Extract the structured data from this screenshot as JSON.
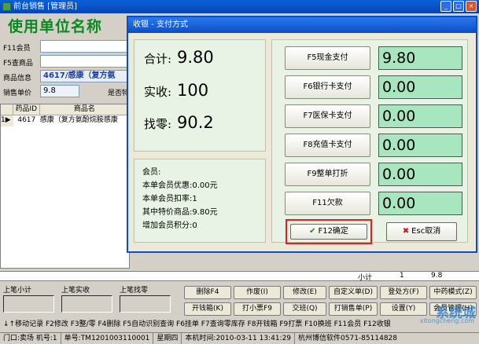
{
  "main": {
    "title": "前台销售 [管理员]",
    "company_name": "使用单位名称",
    "form": {
      "member_label": "F11会员",
      "search_label": "F5查商品",
      "product_info_label": "商品信息",
      "product_info_value": "4617/感康（复方氨",
      "unit_price_label": "销售单价",
      "unit_price_value": "9.8",
      "special_label": "是否特"
    },
    "grid": {
      "columns": [
        "药品ID",
        "商品名"
      ],
      "rows": [
        {
          "marker": "1▶",
          "id": "4617",
          "name": "感康（复方氨酚烷胺感康"
        }
      ]
    },
    "bottom_strip": {
      "total_label": "小计",
      "qty": "1",
      "amount": "9.8"
    },
    "last": {
      "subtotal_label": "上笔小计",
      "received_label": "上笔实收",
      "change_label": "上笔找零"
    },
    "buttons": {
      "delete": "删除F4",
      "void": "作废(I)",
      "modify": "修改(E)",
      "custom_order": "自定义单(D)",
      "prescription": "登处方(F)",
      "tcm_mode": "中药模式(Z)",
      "open_drawer": "开钱箱(K)",
      "print_ticket": "打小票F9",
      "handover": "交班(Q)",
      "print_order": "打销售单(P)",
      "settings": "设置(Y)",
      "member_mgmt": "会员管理(H)"
    },
    "shortcut_bar": "↓↑移动记录 F2修改 F3整/零 F4删除 F5自动识别查询 F6挂单 F7查询零库存 F8开钱箱 F9打票 F10换班 F11会员 F12收银",
    "status": {
      "counter": "门口:卖场 机号:1",
      "order_no": "单号:TM1201003110001",
      "weekday": "星期四",
      "time": "本机时间:2010-03-11 13:41:29",
      "vendor": "杭州博信软件0571-85114828"
    },
    "watermark": "系统城",
    "watermark_sub": "xitongcheng.com"
  },
  "dialog": {
    "title": "收银 - 支付方式",
    "summary": {
      "total_label": "合计:",
      "total_value": "9.80",
      "received_label": "实收:",
      "received_value": "100",
      "change_label": "找零:",
      "change_value": "90.2"
    },
    "member": {
      "member_label": "会员:",
      "discount_line": "本单会员优惠:0.00元",
      "rate_line": "本单会员扣率:1",
      "special_line": "其中特价商品:9.80元",
      "points_line": "增加会员积分:0"
    },
    "payments": [
      {
        "label": "F5现金支付",
        "amount": "9.80"
      },
      {
        "label": "F6银行卡支付",
        "amount": "0.00"
      },
      {
        "label": "F7医保卡支付",
        "amount": "0.00"
      },
      {
        "label": "F8充值卡支付",
        "amount": "0.00"
      },
      {
        "label": "F9整单打折",
        "amount": "0.00"
      },
      {
        "label": "F11欠款",
        "amount": "0.00"
      }
    ],
    "confirm_label": "F12确定",
    "cancel_label": "Esc取消"
  }
}
